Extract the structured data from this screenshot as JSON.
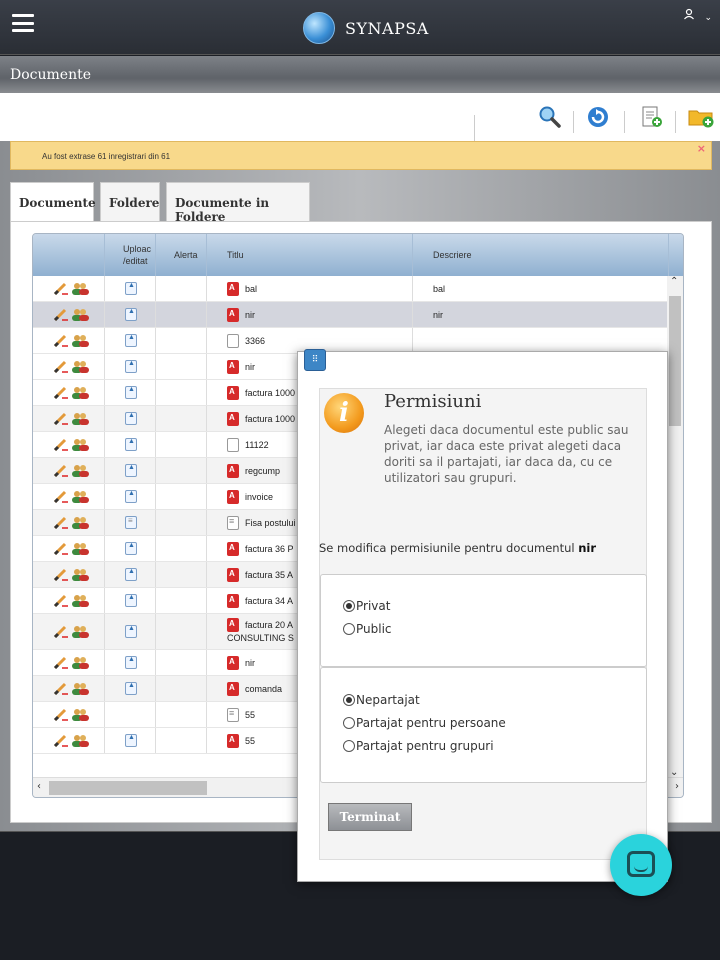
{
  "app": {
    "name": "SYNAPSA"
  },
  "section": {
    "title": "Documente"
  },
  "notice": {
    "text": "Au fost extrase 61 inregistrari din 61",
    "close": "×"
  },
  "tabs": [
    {
      "label": "Documente",
      "active": true
    },
    {
      "label": "Foldere",
      "active": false
    },
    {
      "label": "Documente in Foldere",
      "active": false
    }
  ],
  "grid": {
    "columns": [
      "",
      "Uploac /editat",
      "Alerta",
      "Titlu",
      "Descriere"
    ],
    "rows": [
      {
        "title": "bal",
        "desc": "bal",
        "upload": "up",
        "file": "pdf",
        "state": ""
      },
      {
        "title": "nir",
        "desc": "nir",
        "upload": "up",
        "file": "pdf",
        "state": "sel"
      },
      {
        "title": "3366",
        "desc": "",
        "upload": "up",
        "file": "plain",
        "state": ""
      },
      {
        "title": "nir",
        "desc": "",
        "upload": "up",
        "file": "pdf",
        "state": ""
      },
      {
        "title": "factura 1000",
        "desc": "",
        "upload": "up",
        "file": "pdf",
        "state": ""
      },
      {
        "title": "factura 1000",
        "desc": "",
        "upload": "up",
        "file": "pdf",
        "state": "alt"
      },
      {
        "title": "11122",
        "desc": "",
        "upload": "up",
        "file": "plain",
        "state": ""
      },
      {
        "title": "regcump",
        "desc": "",
        "upload": "up",
        "file": "pdf",
        "state": "alt"
      },
      {
        "title": "invoice",
        "desc": "",
        "upload": "up",
        "file": "pdf",
        "state": ""
      },
      {
        "title": "Fisa postului",
        "desc": "",
        "upload": "doc",
        "file": "txt",
        "state": "alt"
      },
      {
        "title": "factura 36 P",
        "desc": "",
        "upload": "up",
        "file": "pdf",
        "state": ""
      },
      {
        "title": "factura 35 A",
        "desc": "",
        "upload": "up",
        "file": "pdf",
        "state": "alt"
      },
      {
        "title": "factura 34 A",
        "desc": "",
        "upload": "up",
        "file": "pdf",
        "state": ""
      },
      {
        "title": "factura 20 A",
        "title2": "CONSULTING S",
        "desc": "",
        "upload": "up",
        "file": "pdf",
        "state": "alt"
      },
      {
        "title": "nir",
        "desc": "",
        "upload": "up",
        "file": "pdf",
        "state": ""
      },
      {
        "title": "comanda",
        "desc": "",
        "upload": "up",
        "file": "pdf",
        "state": "alt"
      },
      {
        "title": "55",
        "desc": "",
        "upload": "",
        "file": "txt",
        "state": ""
      },
      {
        "title": "55",
        "desc": "",
        "upload": "up",
        "file": "pdf",
        "state": ""
      }
    ]
  },
  "modal": {
    "title": "Permisiuni",
    "description": "Alegeti daca documentul este public sau privat, iar daca este privat alegeti daca doriti sa il partajati, iar daca da, cu ce utilizatori sau grupuri.",
    "modify_prefix": "Se modifica permisiunile pentru documentul ",
    "document_name": "nir",
    "visibility": [
      {
        "label": "Privat",
        "checked": true
      },
      {
        "label": "Public",
        "checked": false
      }
    ],
    "sharing": [
      {
        "label": "Nepartajat",
        "checked": true
      },
      {
        "label": "Partajat pentru persoane",
        "checked": false
      },
      {
        "label": "Partajat pentru grupuri",
        "checked": false
      }
    ],
    "done_label": "Terminat"
  },
  "colors": {
    "accent": "#3d86c6",
    "notice": "#f8d98b",
    "pdf": "#d62a2a",
    "chat": "#2ad3dc"
  },
  "icons": [
    "menu-icon",
    "globe-logo-icon",
    "user-icon",
    "search-icon",
    "refresh-icon",
    "new-document-icon",
    "new-folder-icon",
    "info-icon",
    "chat-icon"
  ]
}
